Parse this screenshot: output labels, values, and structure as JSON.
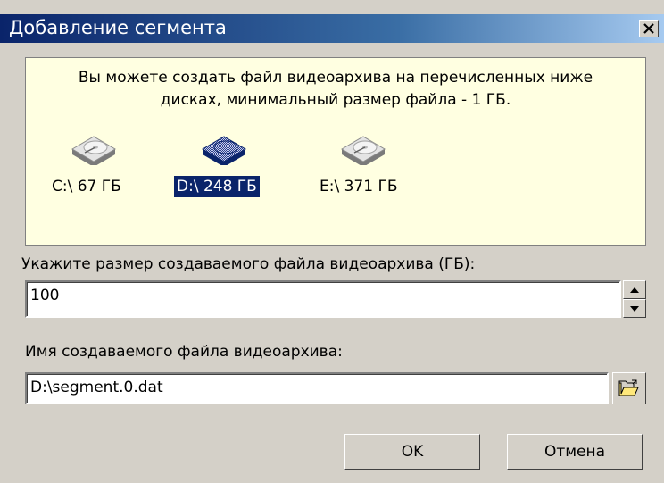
{
  "window": {
    "title": "Добавление сегмента",
    "close_icon": "close-icon"
  },
  "info": {
    "line1": "Вы можете создать файл видеоархива на перечисленных ниже",
    "line2": "дисках, минимальный размер файла - 1 ГБ."
  },
  "disks": [
    {
      "label": "C:\\ 67 ГБ",
      "icon": "hard-disk-icon",
      "selected": false
    },
    {
      "label": "D:\\ 248 ГБ",
      "icon": "hard-disk-icon",
      "selected": true
    },
    {
      "label": "E:\\ 371 ГБ",
      "icon": "hard-disk-icon",
      "selected": false
    }
  ],
  "size": {
    "label": "Укажите размер создаваемого файла видеоархива (ГБ):",
    "value": "100"
  },
  "filename": {
    "label": "Имя создаваемого файла видеоархива:",
    "value": "D:\\segment.0.dat",
    "browse_icon": "open-folder-icon"
  },
  "buttons": {
    "ok": "OK",
    "cancel": "Отмена"
  },
  "colors": {
    "title_bar": "#0a246a",
    "dialog_bg": "#d4d0c8",
    "info_bg": "#ffffe1",
    "selection": "#0a246a"
  }
}
